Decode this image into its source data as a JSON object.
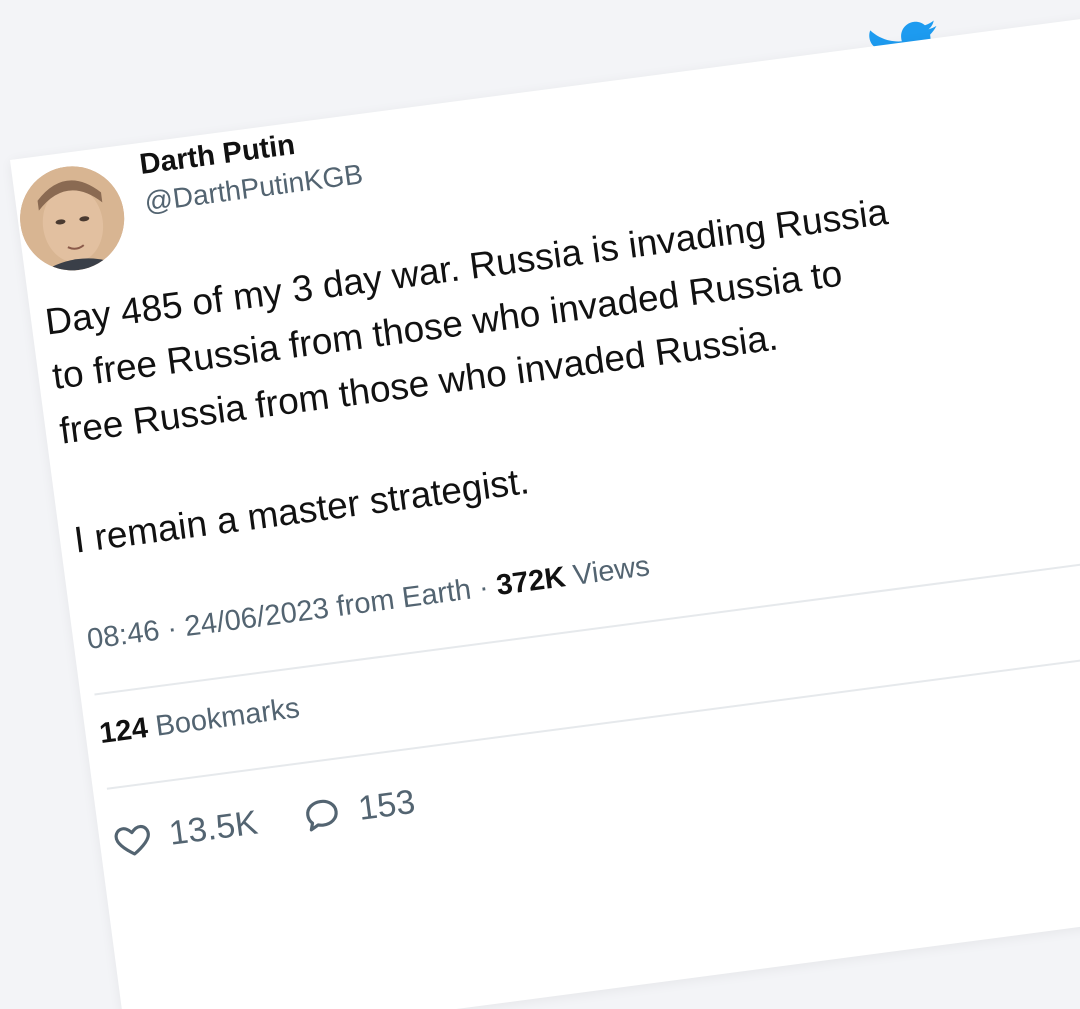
{
  "tweet": {
    "author_name": "Darth Putin",
    "author_handle": "@DarthPutinKGB",
    "body_lines": [
      "Day 485 of my 3 day war. Russia is invading Russia",
      "to free Russia from those who invaded Russia to",
      "free Russia from those who invaded Russia."
    ],
    "body_last": "I remain a master strategist.",
    "time": "08:46",
    "date": "24/06/2023",
    "source": "from Earth",
    "views_count": "372K",
    "views_label": "Views",
    "separator": "·",
    "bookmarks_count": "124",
    "bookmarks_label": "Bookmarks",
    "likes": "13.5K",
    "replies": "153"
  },
  "icons": {
    "logo": "twitter-bird-icon",
    "like": "heart-icon",
    "reply": "speech-bubble-icon"
  },
  "colors": {
    "brand": "#1d9bf0",
    "text_primary": "#111111",
    "text_secondary": "#536471",
    "background": "#f3f4f7"
  }
}
